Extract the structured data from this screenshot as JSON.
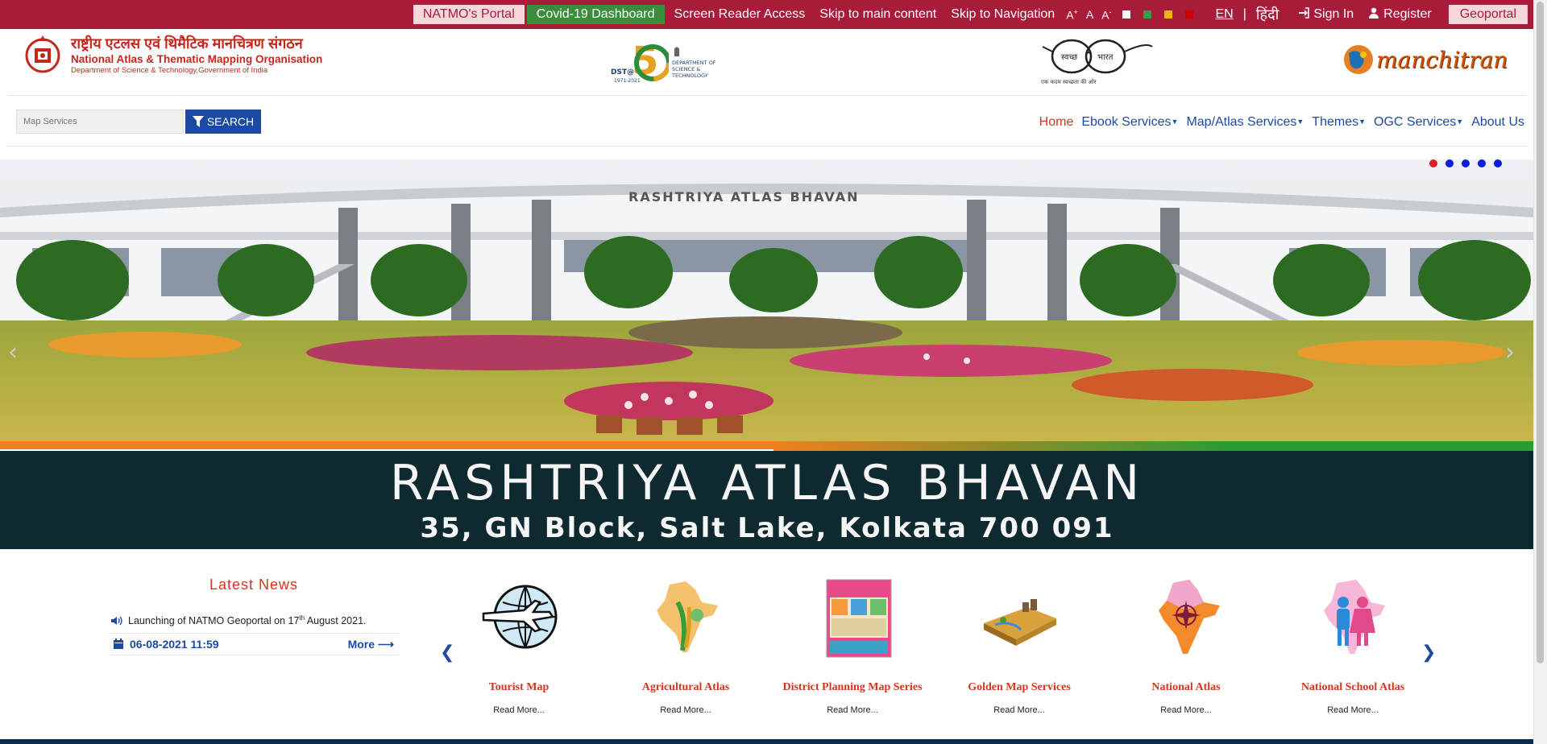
{
  "topbar": {
    "natmo_portal": "NATMO's Portal",
    "covid": "Covid-19 Dashboard",
    "screen_reader": "Screen Reader Access",
    "skip_main": "Skip to main content",
    "skip_nav": "Skip to Navigation",
    "font_increase": "A+",
    "font_normal": "A",
    "font_decrease": "A-",
    "lang_en": "EN",
    "lang_sep": "|",
    "lang_hi": "हिंदी",
    "sign_in": "Sign In",
    "register": "Register",
    "geoportal": "Geoportal",
    "contrast_colors": [
      "#ffffff",
      "#2ea043",
      "#e6b800",
      "#d00000"
    ]
  },
  "header": {
    "org_hindi": "राष्ट्रीय एटलस एवं थिमैटिक मानचित्रण संगठन",
    "org_english": "National Atlas & Thematic Mapping Organisation",
    "org_dept": "Department of Science & Technology,Government of India",
    "dst_label": "DST@",
    "dst_years": "1971-2021",
    "dst_dept": "DEPARTMENT OF SCIENCE & TECHNOLOGY",
    "swachh_1": "स्वच्छ",
    "swachh_2": "भारत",
    "swachh_tag": "एक कदम स्वच्छता की ओर",
    "manchitran": "manchitran"
  },
  "nav": {
    "search_placeholder": "Map Services",
    "search_button": "SEARCH",
    "menu": [
      "Home",
      "Ebook Services",
      "Map/Atlas Services",
      "Themes",
      "OGC Services",
      "About Us"
    ]
  },
  "banner": {
    "building_sign": "RASHTRIYA ATLAS BHAVAN",
    "title": "RASHTRIYA ATLAS BHAVAN",
    "address": "35, GN Block, Salt Lake, Kolkata 700 091",
    "slide_count": 5,
    "active_slide": 1
  },
  "news": {
    "title": "Latest News",
    "item_text": "Launching of NATMO Geoportal on 17th August 2021.",
    "date": "06-08-2021 11:59",
    "more": "More"
  },
  "services": [
    {
      "title": "Tourist Map",
      "read_more": "Read More..."
    },
    {
      "title": "Agricultural Atlas",
      "read_more": "Read More..."
    },
    {
      "title": "District Planning Map Series",
      "read_more": "Read More..."
    },
    {
      "title": "Golden Map Services",
      "read_more": "Read More..."
    },
    {
      "title": "National Atlas",
      "read_more": "Read More..."
    },
    {
      "title": "National School Atlas",
      "read_more": "Read More..."
    }
  ]
}
